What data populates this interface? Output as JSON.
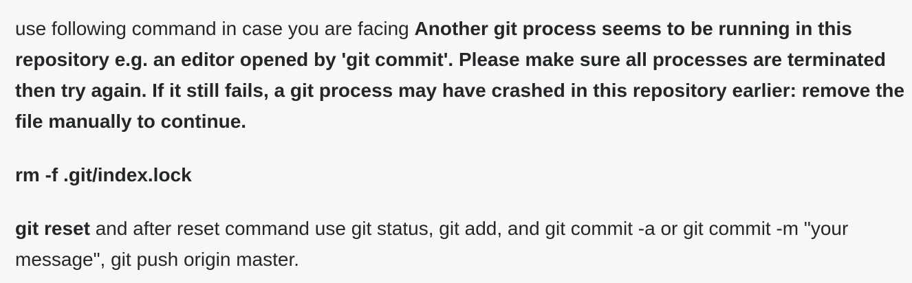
{
  "answer": {
    "intro_text": "use following command in case you are facing ",
    "error_message": "Another git process seems to be running in this repository e.g. an editor opened by 'git commit'. Please make sure all processes are terminated then try again. If it still fails, a git process may have crashed in this repository earlier: remove the file manually to continue.",
    "command": "rm -f .git/index.lock",
    "reset_label": "git reset",
    "reset_text": " and after reset command use git status, git add, and git commit -a or git commit -m \"your message\", git push origin master."
  }
}
